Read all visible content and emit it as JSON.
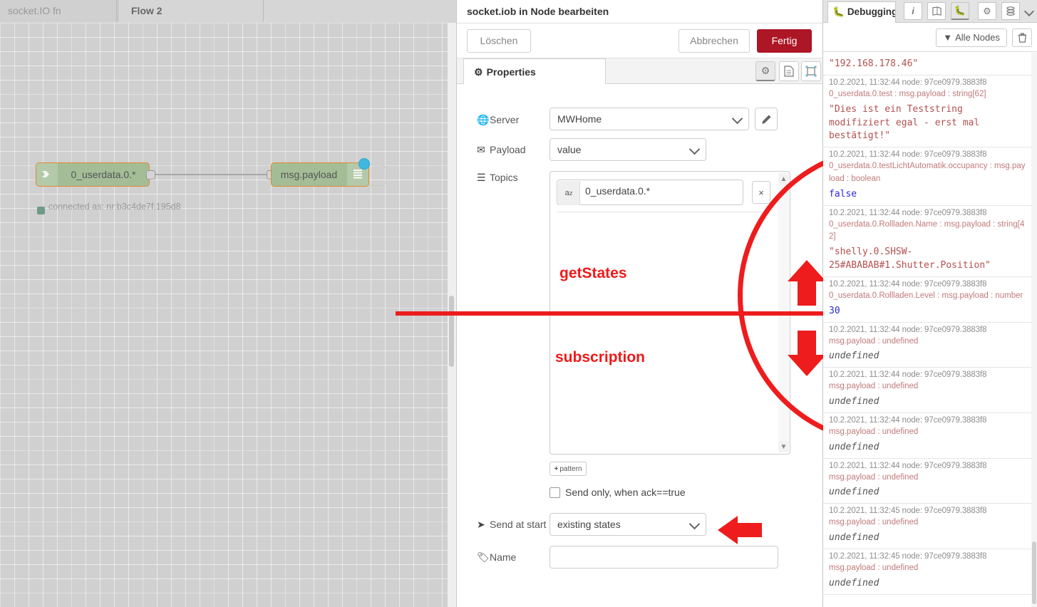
{
  "canvas": {
    "tabs": [
      {
        "label": "socket.IO fn",
        "active": false
      },
      {
        "label": "Flow 2",
        "active": true
      }
    ],
    "nodes": [
      {
        "label": "0_userdata.0.*",
        "icon": "arrow-right-icon"
      },
      {
        "label": "msg.payload",
        "icon": "debug-bars-icon"
      }
    ],
    "status_text": "connected as: nr:b3c4de7f.195d8"
  },
  "dialog": {
    "title": "socket.iob in Node bearbeiten",
    "buttons": {
      "delete": "Löschen",
      "cancel": "Abbrechen",
      "done": "Fertig"
    },
    "tabs": [
      {
        "label": "Properties",
        "icon": "gear-icon",
        "active": true
      }
    ],
    "tab_icons": [
      "gear-icon",
      "document-icon",
      "appearance-icon"
    ],
    "fields": {
      "server": {
        "label": "Server",
        "icon": "globe-icon",
        "value": "MWHome",
        "edit_icon": "pencil-icon"
      },
      "payload": {
        "label": "Payload",
        "icon": "envelope-icon",
        "value": "value"
      },
      "topics": {
        "label": "Topics",
        "icon": "list-icon",
        "items": [
          {
            "type_icon": "az-icon",
            "value": "0_userdata.0.*",
            "remove": "×"
          }
        ]
      },
      "pattern_button": {
        "label": "pattern",
        "plus": "+"
      },
      "ack_checkbox": {
        "label": "Send only, when ack==true",
        "checked": false
      },
      "send_at_start": {
        "label": "Send at start",
        "icon": "send-icon",
        "value": "existing states"
      },
      "name": {
        "label": "Name",
        "icon": "tag-icon",
        "value": "",
        "placeholder": ""
      }
    }
  },
  "annotations": {
    "get_states": "getStates",
    "subscription": "subscription",
    "color": "#ee1c1c",
    "arrows": [
      "arrow-up-annotation",
      "arrow-down-annotation",
      "arrow-left-annotation"
    ],
    "circle": "circle-highlight",
    "line": "horizontal-divider-line"
  },
  "sidebar": {
    "tab_label": "Debugging",
    "tab_icon": "bug-icon",
    "icons": [
      "info-icon",
      "book-icon",
      "bug-icon",
      "gear-icon",
      "database-icon"
    ],
    "caret": "chevron-down-icon",
    "filter_button": {
      "label": "Alle Nodes",
      "icon": "filter-icon"
    },
    "clear_button": {
      "icon": "trash-icon"
    },
    "entries": [
      {
        "partial_top": true,
        "meta": "",
        "node": "",
        "topic": "",
        "value": "\"192.168.178.46\"",
        "value_type": "string"
      },
      {
        "meta": "10.2.2021, 11:32:44",
        "node": "node: 97ce0979.3883f8",
        "topic": "0_userdata.0.test : msg.payload : string[62]",
        "value": "\"Dies ist ein Teststring modifiziert egal - erst mal bestätigt!\"",
        "value_type": "string"
      },
      {
        "meta": "10.2.2021, 11:32:44",
        "node": "node: 97ce0979.3883f8",
        "topic": "0_userdata.0.testLichtAutomatik.occupancy : msg.payload : boolean",
        "value": "false",
        "value_type": "boolean"
      },
      {
        "meta": "10.2.2021, 11:32:44",
        "node": "node: 97ce0979.3883f8",
        "topic": "0_userdata.0.Rollladen.Name : msg.payload : string[42]",
        "value": "\"shelly.0.SHSW-25#ABABAB#1.Shutter.Position\"",
        "value_type": "string"
      },
      {
        "meta": "10.2.2021, 11:32:44",
        "node": "node: 97ce0979.3883f8",
        "topic": "0_userdata.0.Rollladen.Level : msg.payload : number",
        "value": "30",
        "value_type": "number"
      },
      {
        "meta": "10.2.2021, 11:32:44",
        "node": "node: 97ce0979.3883f8",
        "topic": "msg.payload : undefined",
        "value": "undefined",
        "value_type": "undefined"
      },
      {
        "meta": "10.2.2021, 11:32:44",
        "node": "node: 97ce0979.3883f8",
        "topic": "msg.payload : undefined",
        "value": "undefined",
        "value_type": "undefined"
      },
      {
        "meta": "10.2.2021, 11:32:44",
        "node": "node: 97ce0979.3883f8",
        "topic": "msg.payload : undefined",
        "value": "undefined",
        "value_type": "undefined"
      },
      {
        "meta": "10.2.2021, 11:32:44",
        "node": "node: 97ce0979.3883f8",
        "topic": "msg.payload : undefined",
        "value": "undefined",
        "value_type": "undefined"
      },
      {
        "meta": "10.2.2021, 11:32:45",
        "node": "node: 97ce0979.3883f8",
        "topic": "msg.payload : undefined",
        "value": "undefined",
        "value_type": "undefined"
      },
      {
        "meta": "10.2.2021, 11:32:45",
        "node": "node: 97ce0979.3883f8",
        "topic": "msg.payload : undefined",
        "value": "undefined",
        "value_type": "undefined"
      }
    ]
  }
}
